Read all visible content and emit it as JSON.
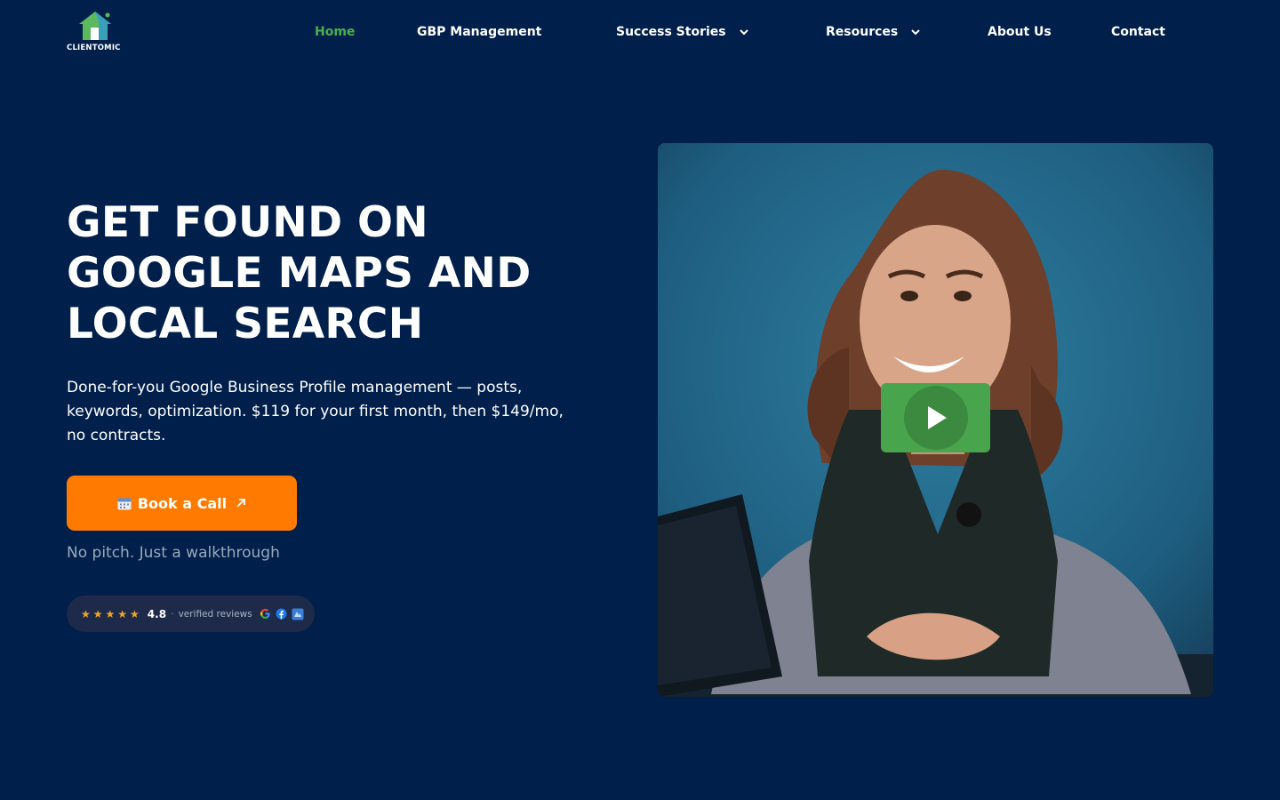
{
  "brand": {
    "name": "CLIENTOMIC",
    "accent": "#4caf50",
    "cta_color": "#ff7a00",
    "background": "#001f4a"
  },
  "nav": {
    "items": [
      {
        "label": "Home",
        "active": true
      },
      {
        "label": "GBP Management"
      },
      {
        "label": "Success Stories",
        "dropdown": true
      },
      {
        "label": "Resources",
        "dropdown": true
      },
      {
        "label": "About Us"
      },
      {
        "label": "Contact"
      }
    ]
  },
  "hero": {
    "title_lines": [
      "GET FOUND ON",
      "GOOGLE MAPS AND",
      "LOCAL SEARCH"
    ],
    "subtitle": "Done-for-you Google Business Profile management — posts, keywords, optimization. $119 for your first month, then $149/mo, no contracts.",
    "cta_label": "Book a Call",
    "note": "No pitch. Just a walkthrough"
  },
  "reviews": {
    "stars": "★★★★★",
    "rating": "4.8",
    "separator": "·",
    "label": "verified reviews",
    "icons": [
      "google-icon",
      "facebook-icon",
      "review-platform-icon"
    ]
  },
  "video": {
    "icon": "play-icon"
  }
}
